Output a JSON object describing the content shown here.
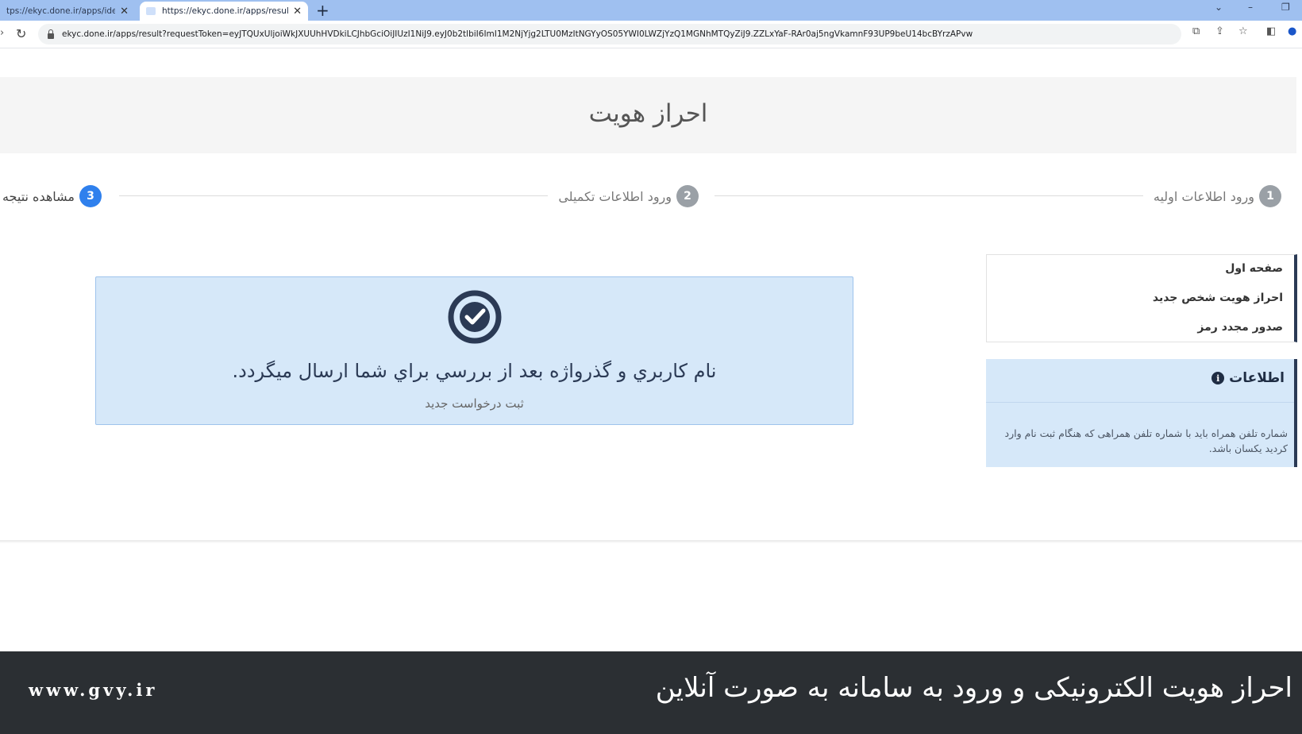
{
  "browser": {
    "tabs": [
      {
        "title": "tps://ekyc.done.ir/apps/identit",
        "active": false
      },
      {
        "title": "https://ekyc.done.ir/apps/result?",
        "active": true
      }
    ],
    "url": "ekyc.done.ir/apps/result?requestToken=eyJTQUxUljoiWkJXUUhHVDkiLCJhbGciOiJIUzI1NiJ9.eyJ0b2tlbiI6ImI1M2NjYjg2LTU0MzItNGYyOS05YWI0LWZjYzQ1MGNhMTQyZiJ9.ZZLxYaF-RAr0aj5ngVkamnF93UP9beU14bcBYrzAPvw"
  },
  "page": {
    "title": "احراز هویت"
  },
  "steps": [
    {
      "number": "1",
      "label": "ورود اطلاعات اولیه",
      "state": "done"
    },
    {
      "number": "2",
      "label": "ورود اطلاعات تکمیلی",
      "state": "done"
    },
    {
      "number": "3",
      "label": "مشاهده نتیجه",
      "state": "active"
    }
  ],
  "sidebar": {
    "items": [
      {
        "label": "صفحه اول"
      },
      {
        "label": "احراز هویت شخص جدید"
      },
      {
        "label": "صدور مجدد رمز"
      }
    ]
  },
  "info": {
    "title": "اطلاعات",
    "body": "شماره تلفن همراه باید با شماره تلفن همراهی که هنگام ثبت نام وارد کردید یکسان باشد."
  },
  "result": {
    "message": "نام كاربري و گذرواژه بعد از بررسي براي شما ارسال ميگردد.",
    "new_request": "ثبت درخواست جدید"
  },
  "caption": {
    "text": "احراز هویت الکترونیکی و ورود به سامانه به صورت آنلاین",
    "site": "www.gvy.ir"
  },
  "colors": {
    "accent_blue": "#2f80ed",
    "alert_bg": "#d6e8f9",
    "sidebar_accent": "#2b3a55",
    "caption_bg": "#2b2f33"
  },
  "icons": [
    "back-icon",
    "reload-icon",
    "lock-icon",
    "translate-icon",
    "share-icon",
    "star-icon",
    "sidepanel-icon",
    "profile-icon",
    "check-circle-icon",
    "info-icon"
  ]
}
